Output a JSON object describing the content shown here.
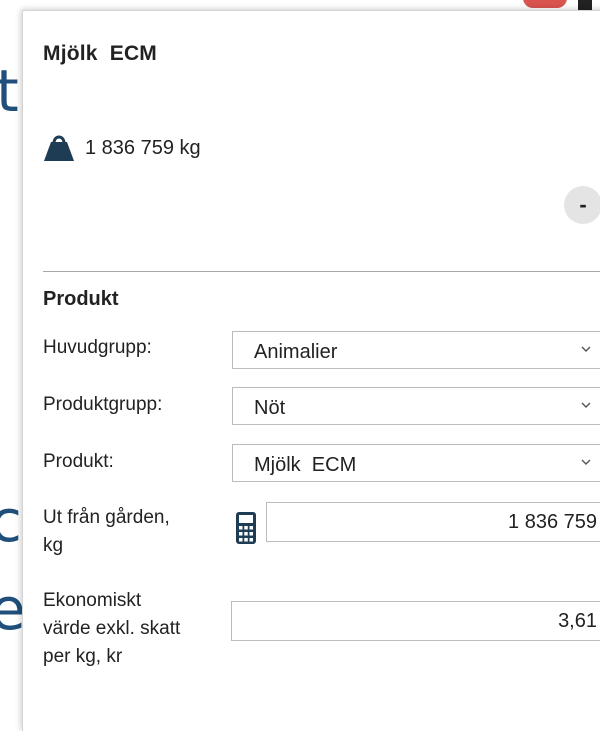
{
  "background": {
    "glyph_1": "t",
    "glyph_2": "c",
    "glyph_3": "e"
  },
  "panel": {
    "title": "Mjölk  ECM",
    "weight_value": "1 836 759 kg",
    "collapse_label": "-"
  },
  "produkt": {
    "section_title": "Produkt",
    "huvudgrupp_label": "Huvudgrupp:",
    "huvudgrupp_value": "Animalier",
    "produktgrupp_label": "Produktgrupp:",
    "produktgrupp_value": "Nöt",
    "produkt_label": "Produkt:",
    "produkt_value": "Mjölk  ECM",
    "ut_fran_garden_label_line1": "Ut från gården,",
    "ut_fran_garden_label_line2": "kg",
    "ut_fran_garden_value": "1 836 759",
    "ekonomiskt_label_line1": "Ekonomiskt",
    "ekonomiskt_label_line2": "värde exkl. skatt",
    "ekonomiskt_label_line3": "per kg, kr",
    "ekonomiskt_value": "3,61"
  },
  "colors": {
    "icon_dark": "#1f3c55",
    "background_text": "#1f4f7a",
    "accent_red": "#d9534f"
  },
  "icons": [
    "weight-icon",
    "calculator-icon",
    "chevron-down-icon"
  ]
}
